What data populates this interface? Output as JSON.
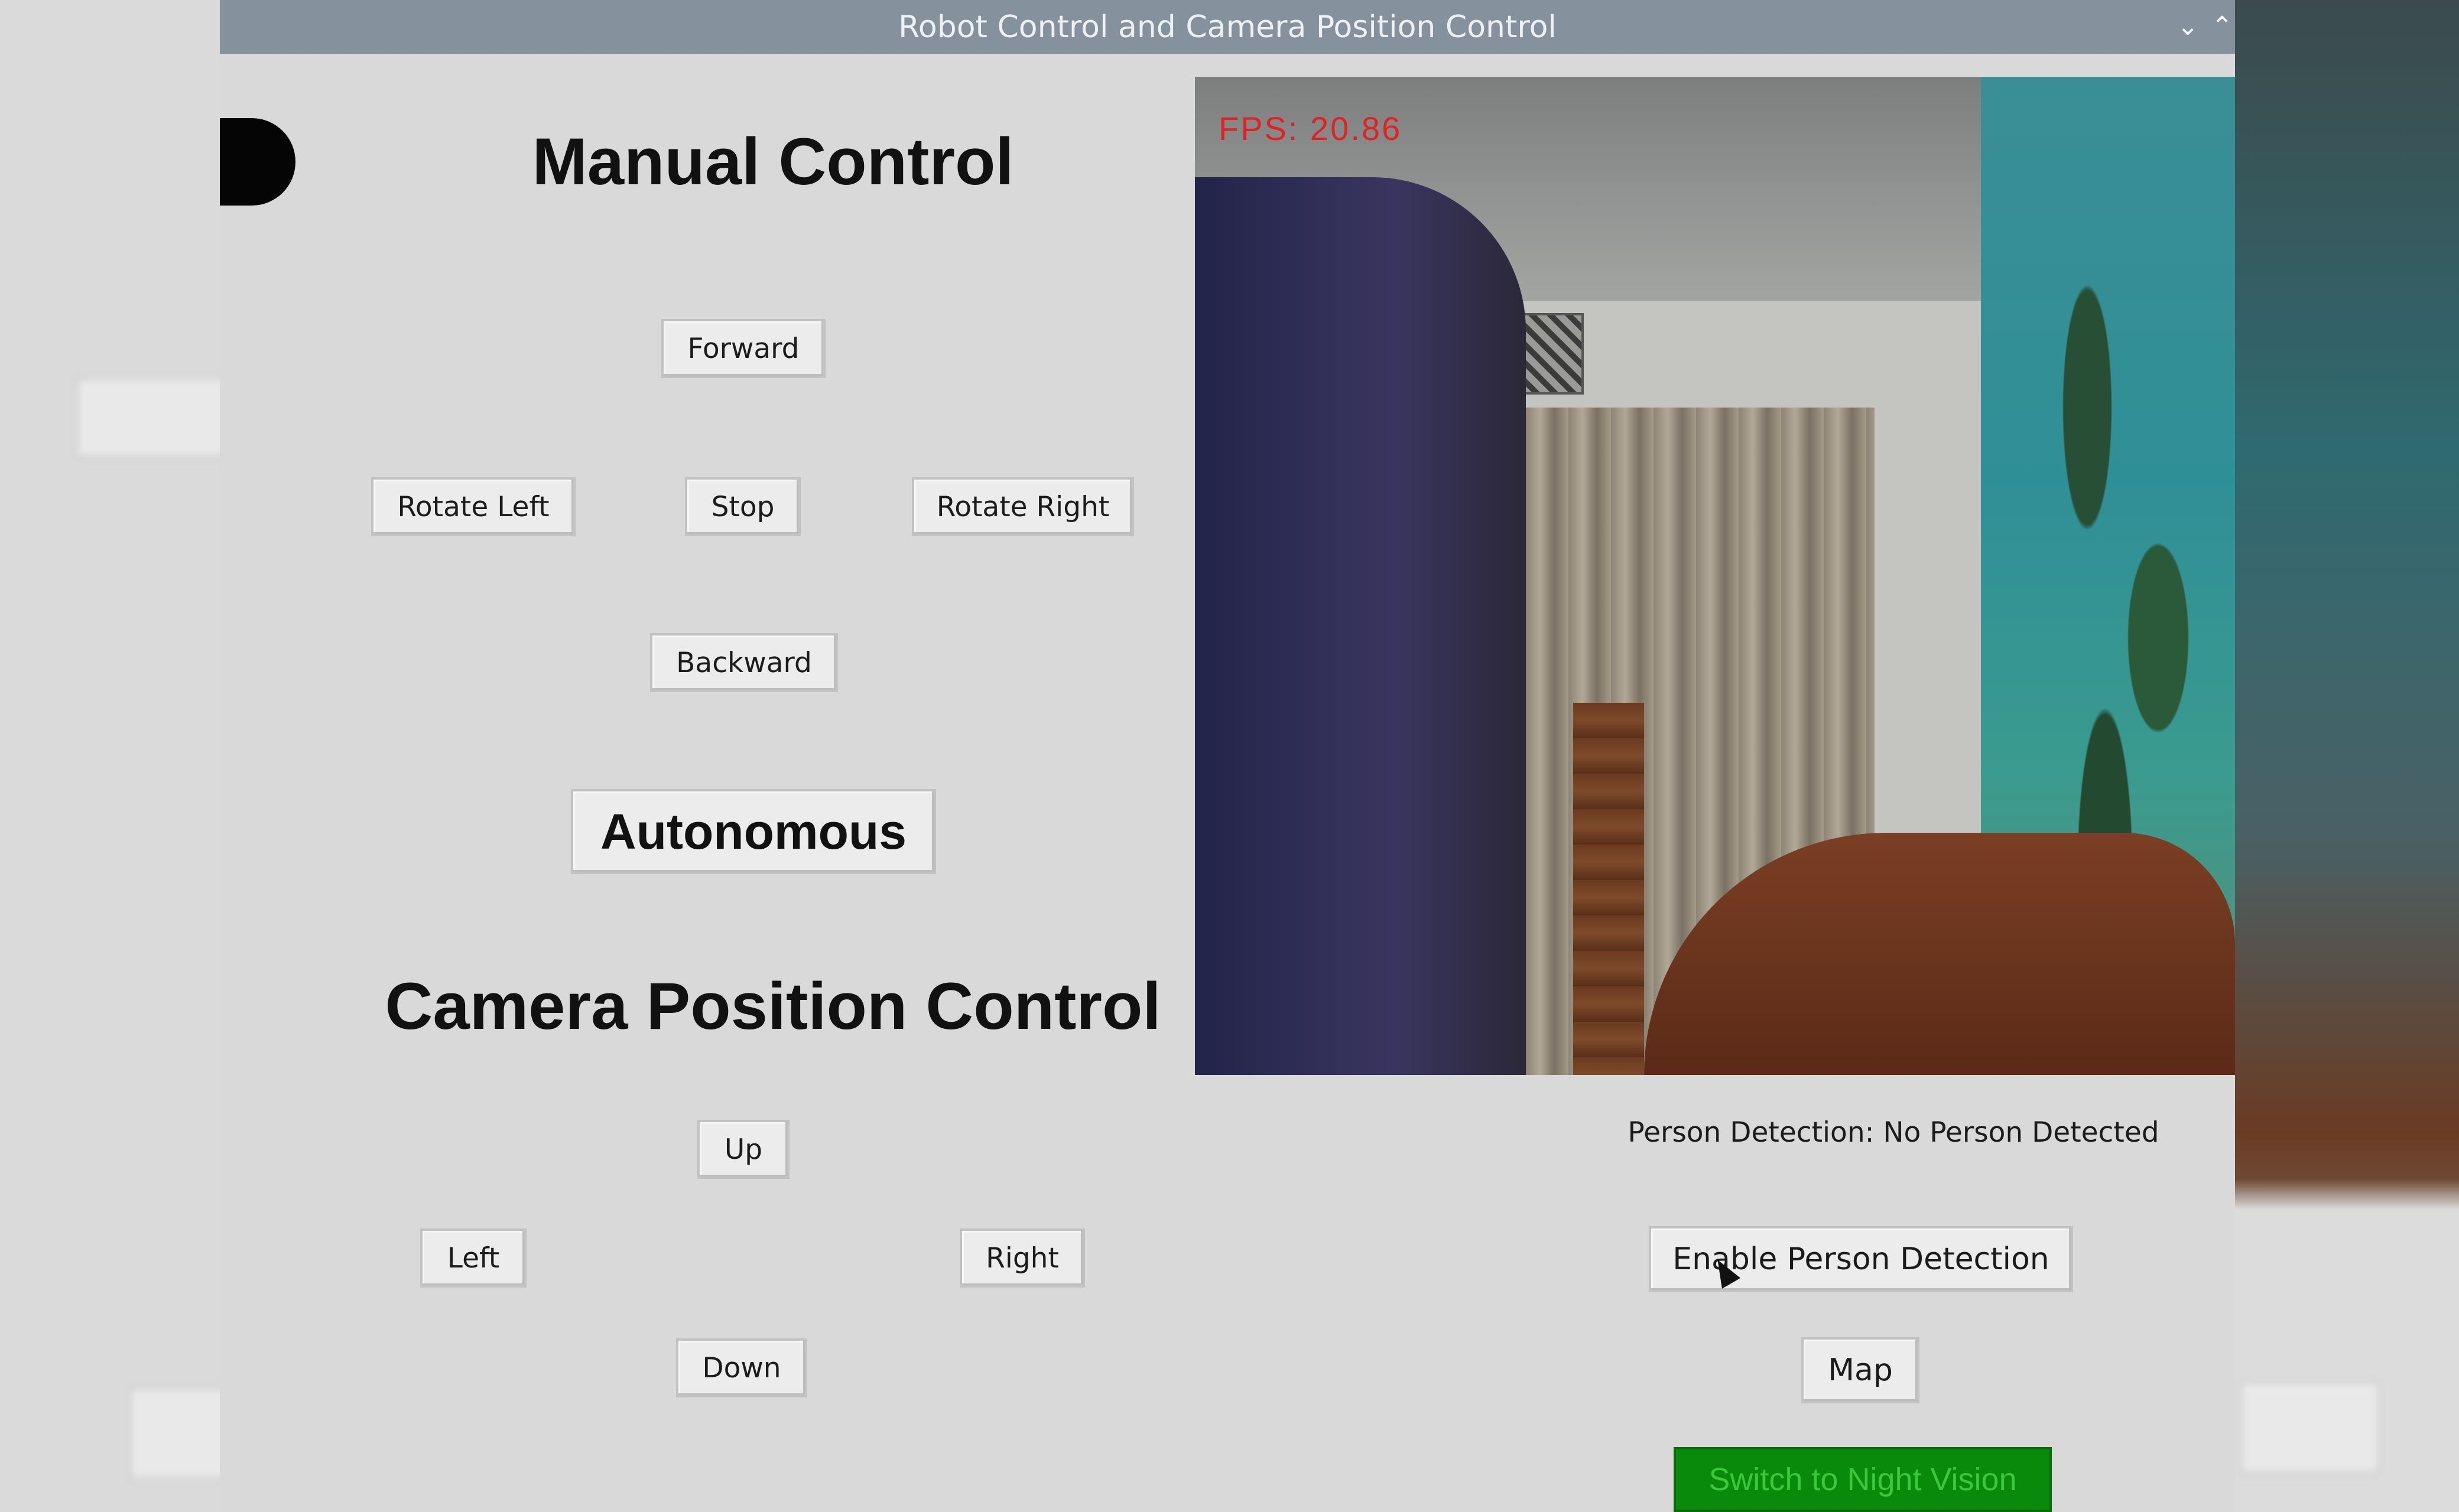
{
  "window": {
    "title": "Robot Control and Camera Position Control",
    "minimize_icon": "chevron-down-icon",
    "maximize_icon": "chevron-up-icon"
  },
  "manual_control": {
    "heading": "Manual Control",
    "forward": "Forward",
    "rotate_left": "Rotate Left",
    "stop": "Stop",
    "rotate_right": "Rotate Right",
    "backward": "Backward",
    "autonomous": "Autonomous"
  },
  "camera_control": {
    "heading": "Camera Position Control",
    "up": "Up",
    "left": "Left",
    "right": "Right",
    "down": "Down"
  },
  "camera_feed": {
    "fps_label": "FPS: 20.86"
  },
  "detection": {
    "status_text": "Person Detection: No Person Detected",
    "enable_label": "Enable Person Detection",
    "map_label": "Map",
    "night_vision_label": "Switch to Night Vision"
  },
  "colors": {
    "titlebar": "#85919c",
    "window_bg": "#d9d9d9",
    "night_vision_bg": "#0a8a0a",
    "night_vision_text": "#3cc73c",
    "fps_text": "#e22222"
  }
}
